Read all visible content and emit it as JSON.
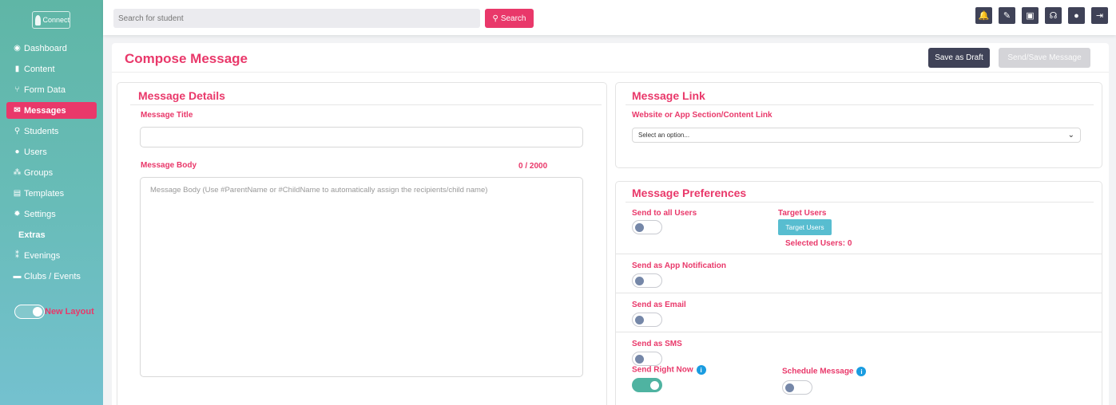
{
  "sidebar": {
    "logo_text": "Connect",
    "items": [
      {
        "label": "Dashboard",
        "icon": "dashboard-icon",
        "glyph": "◉"
      },
      {
        "label": "Content",
        "icon": "content-icon",
        "glyph": "▮"
      },
      {
        "label": "Form Data",
        "icon": "form-data-icon",
        "glyph": "⑂"
      },
      {
        "label": "Messages",
        "icon": "envelope-icon",
        "glyph": "✉"
      },
      {
        "label": "Students",
        "icon": "student-icon",
        "glyph": "⚲"
      },
      {
        "label": "Users",
        "icon": "user-icon",
        "glyph": "●"
      },
      {
        "label": "Groups",
        "icon": "groups-icon",
        "glyph": "⁂"
      },
      {
        "label": "Templates",
        "icon": "templates-icon",
        "glyph": "▤"
      },
      {
        "label": "Settings",
        "icon": "gear-icon",
        "glyph": "✹"
      }
    ],
    "extras_heading": "Extras",
    "extras": [
      {
        "label": "Evenings",
        "icon": "people-icon",
        "glyph": "⁑"
      },
      {
        "label": "Clubs / Events",
        "icon": "calendar-icon",
        "glyph": "▬"
      }
    ],
    "new_layout_label": "New Layout"
  },
  "topbar": {
    "search_placeholder": "Search for student",
    "search_button": "Search",
    "icons": [
      {
        "name": "bell-icon",
        "glyph": "🔔"
      },
      {
        "name": "user-edit-icon",
        "glyph": "✎"
      },
      {
        "name": "id-card-icon",
        "glyph": "▣"
      },
      {
        "name": "headset-icon",
        "glyph": "☊"
      },
      {
        "name": "profile-icon",
        "glyph": "●"
      },
      {
        "name": "logout-icon",
        "glyph": "⇥"
      }
    ]
  },
  "page": {
    "title": "Compose Message",
    "save_draft": "Save as Draft",
    "send_save": "Send/Save Message"
  },
  "details": {
    "title": "Message Details",
    "title_label": "Message Title",
    "title_value": "",
    "body_label": "Message Body",
    "counter": "0 / 2000",
    "body_placeholder": "Message Body (Use #ParentName or #ChildName to automatically assign the recipients/child name)"
  },
  "link": {
    "title": "Message Link",
    "label": "Website or App Section/Content Link",
    "select_value": "Select an option..."
  },
  "prefs": {
    "title": "Message Preferences",
    "send_all_label": "Send to all Users",
    "send_all_on": false,
    "target_label": "Target Users",
    "target_button": "Target Users",
    "selected_users": "Selected Users: 0",
    "app_notification_label": "Send as App Notification",
    "app_notification_on": false,
    "email_label": "Send as Email",
    "email_on": false,
    "sms_label": "Send as SMS",
    "sms_on": false,
    "right_now_label": "Send Right Now",
    "right_now_on": true,
    "schedule_label": "Schedule Message",
    "schedule_on": false
  },
  "colors": {
    "accent": "#e9386a",
    "dark": "#3f4257",
    "teal": "#5fb6a6",
    "info": "#1a9ce0"
  }
}
